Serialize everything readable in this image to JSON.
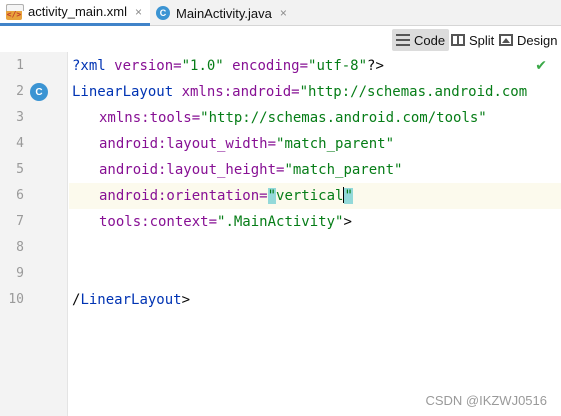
{
  "tabs": [
    {
      "label": "activity_main.xml",
      "icon": "xml-file-icon",
      "active": true
    },
    {
      "label": "MainActivity.java",
      "icon": "java-class-icon",
      "active": false
    }
  ],
  "close_glyph": "×",
  "view_modes": [
    {
      "label": "Code",
      "icon": "code-view-icon",
      "selected": true
    },
    {
      "label": "Split",
      "icon": "split-view-icon",
      "selected": false
    },
    {
      "label": "Design",
      "icon": "design-view-icon",
      "selected": false
    }
  ],
  "gutter": {
    "line_numbers": [
      "1",
      "2",
      "3",
      "4",
      "5",
      "6",
      "7",
      "8",
      "9",
      "10"
    ],
    "class_marker_glyph": "C",
    "class_marker_line": "2"
  },
  "code": {
    "l1": {
      "t1": "?xml ",
      "a1": "version=",
      "v1": "\"1.0\" ",
      "a2": "encoding=",
      "v2": "\"utf-8\"",
      "p1": "?>"
    },
    "l2": {
      "t1": "LinearLayout ",
      "a1": "xmlns:android=",
      "v1": "\"http://schemas.android.com"
    },
    "l3": {
      "a1": "xmlns:tools=",
      "v1": "\"http://schemas.android.com/tools\""
    },
    "l4": {
      "a1": "android:layout_width=",
      "v1": "\"match_parent\""
    },
    "l5": {
      "a1": "android:layout_height=",
      "v1": "\"match_parent\""
    },
    "l6": {
      "a1": "android:orientation=",
      "q1": "\"",
      "v1": "vertical",
      "q2": "\""
    },
    "l7": {
      "a1": "tools:context=",
      "v1": "\".MainActivity\"",
      "p1": ">"
    },
    "l10": {
      "p1": "/",
      "t1": "LinearLayout",
      "p2": ">"
    }
  },
  "status_check": "✔",
  "watermark": "CSDN @IKZWJ0516",
  "colors": {
    "tag": "#0033b3",
    "attribute": "#871094",
    "string": "#067d17",
    "bracket_match": "#93d9d9",
    "current_line": "#fcfaed",
    "tab_underline": "#4083c9"
  }
}
